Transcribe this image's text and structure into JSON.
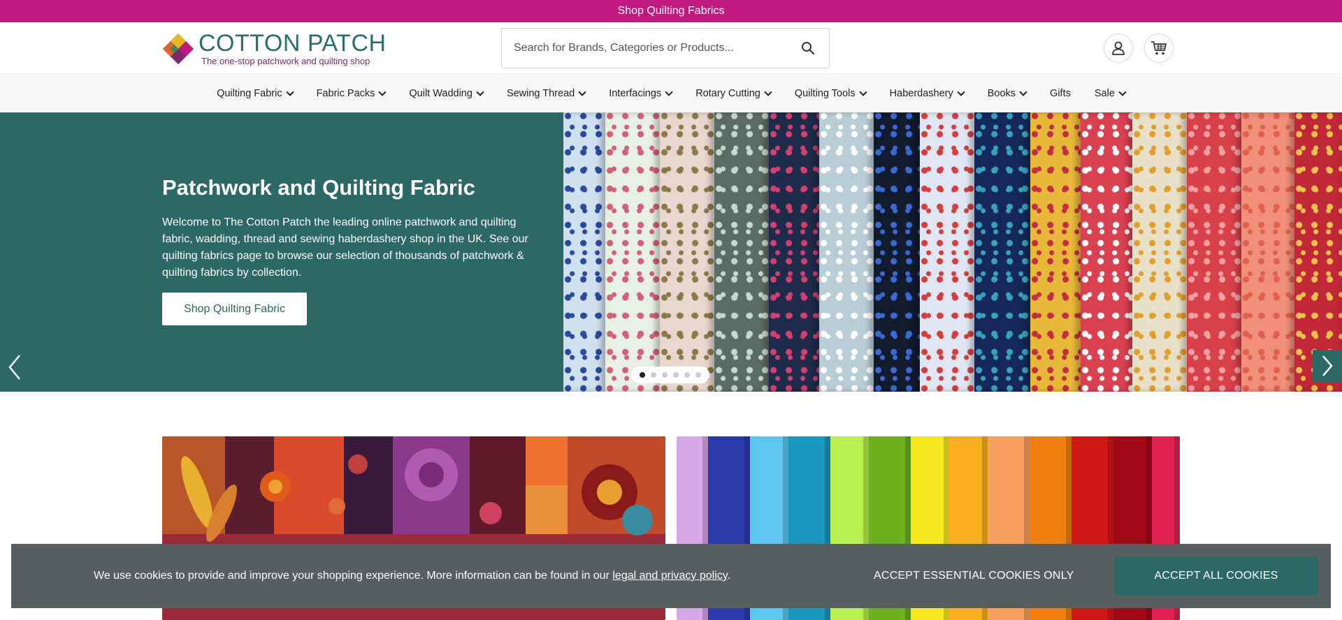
{
  "promo": {
    "text": "Shop Quilting Fabrics"
  },
  "header": {
    "logo_title": "COTTON PATCH",
    "logo_subtitle": "The one-stop patchwork and quilting shop",
    "search_placeholder": "Search for Brands, Categories or Products...",
    "icons": {
      "search": "search-icon",
      "account": "user-icon",
      "cart": "cart-icon"
    }
  },
  "nav": {
    "items": [
      {
        "label": "Quilting Fabric",
        "dropdown": true
      },
      {
        "label": "Fabric Packs",
        "dropdown": true
      },
      {
        "label": "Quilt Wadding",
        "dropdown": true
      },
      {
        "label": "Sewing Thread",
        "dropdown": true
      },
      {
        "label": "Interfacings",
        "dropdown": true
      },
      {
        "label": "Rotary Cutting",
        "dropdown": true
      },
      {
        "label": "Quilting Tools",
        "dropdown": true
      },
      {
        "label": "Haberdashery",
        "dropdown": true
      },
      {
        "label": "Books",
        "dropdown": true
      },
      {
        "label": "Gifts",
        "dropdown": false
      },
      {
        "label": "Sale",
        "dropdown": true
      }
    ]
  },
  "hero": {
    "title": "Patchwork and Quilting Fabric",
    "text": "Welcome to The Cotton Patch the leading online patchwork and quilting fabric, wadding, thread and sewing haberdashery shop in the UK. See our quilting fabrics page to browse our selection of thousands of patchwork & quilting fabrics by collection.",
    "button_label": "Shop Quilting Fabric",
    "slides_total": 6,
    "active_slide": 1
  },
  "cookie": {
    "text": "We use cookies to provide and improve your shopping experience. More information can be found in our ",
    "link_text": "legal and privacy policy",
    "text_end": ".",
    "essential_label": "ACCEPT ESSENTIAL COOKIES ONLY",
    "all_label": "ACCEPT ALL COOKIES"
  },
  "colors": {
    "brand_magenta": "#c01a7f",
    "brand_teal": "#2b6866",
    "cookie_bg": "#585d5d"
  }
}
